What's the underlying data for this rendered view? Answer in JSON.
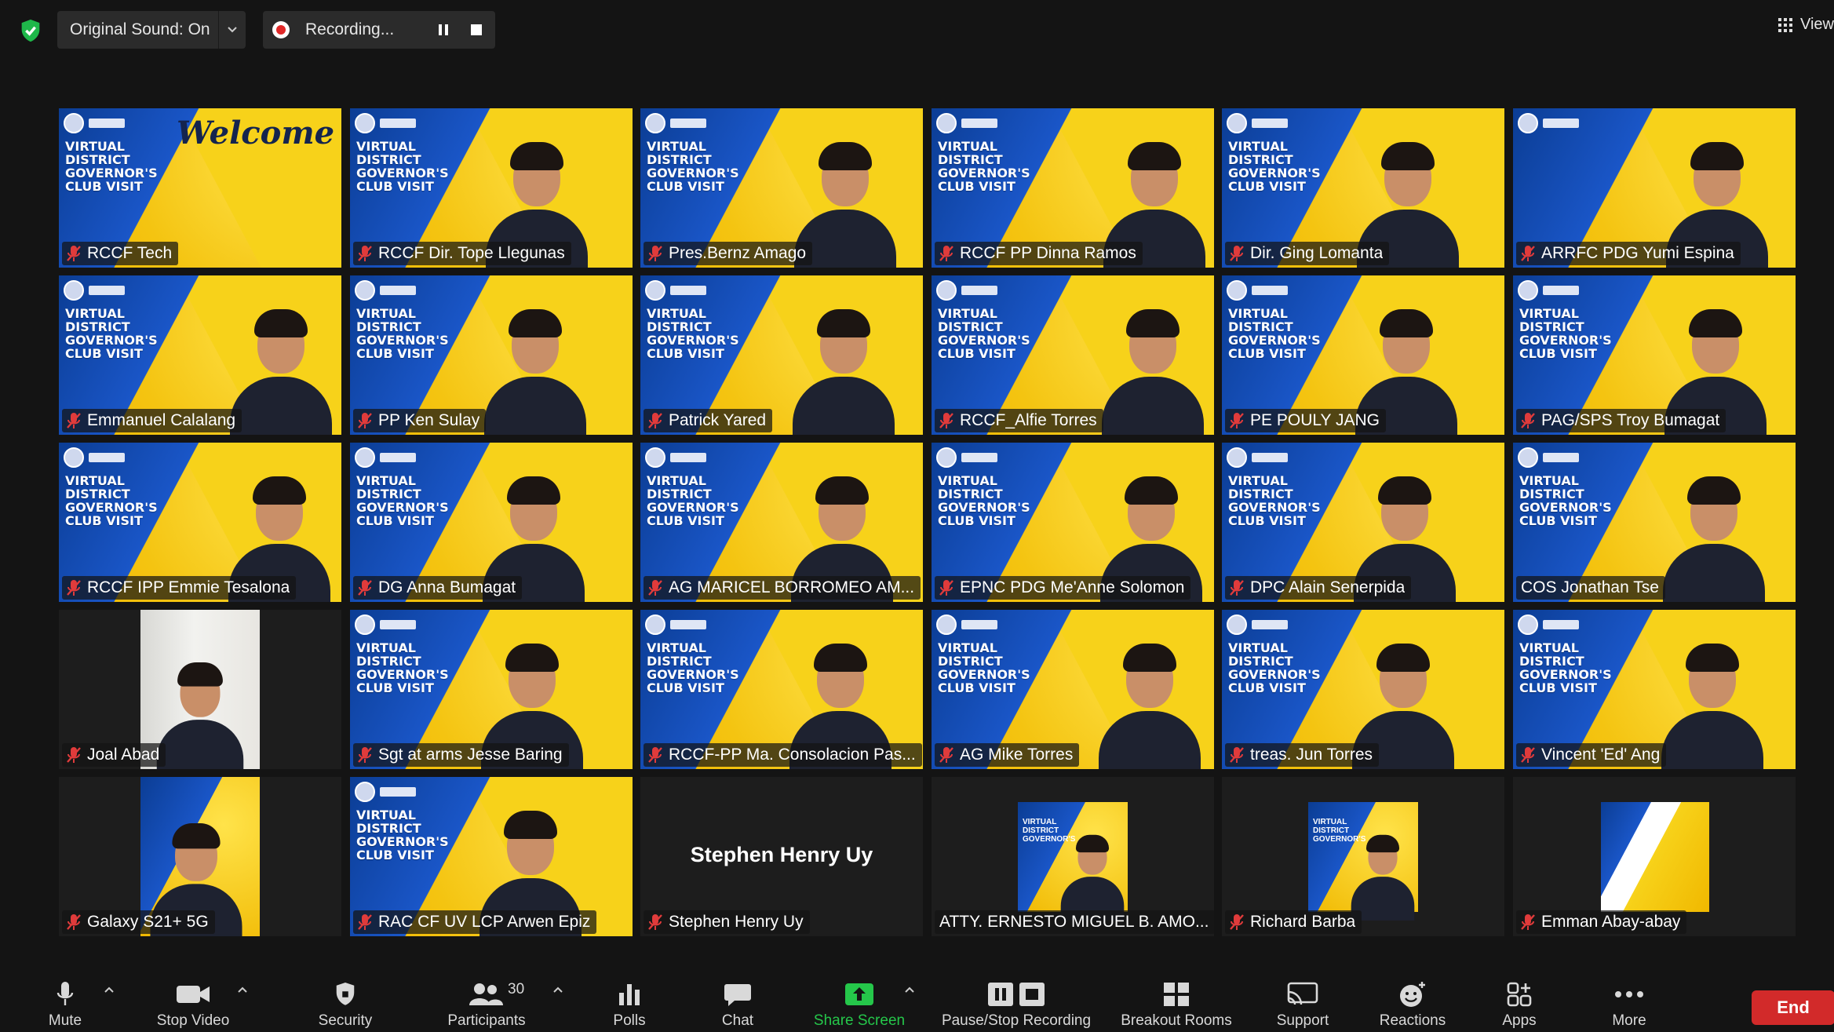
{
  "topbar": {
    "original_sound": "Original Sound: On",
    "recording": "Recording...",
    "view": "View"
  },
  "tiles": [
    {
      "name": "RCCF Tech",
      "bg": "welcome",
      "title": "Welcome",
      "poster": "VIRTUAL DISTRICT GOVERNOR'S CLUB VISIT"
    },
    {
      "name": "RCCF Dir. Tope Llegunas",
      "bg": "poster",
      "active": true,
      "poster": "VIRTUAL DISTRICT GOVERNOR'S CLUB VISIT"
    },
    {
      "name": "Pres.Bernz Amago",
      "bg": "poster",
      "poster": "VIRTUAL DISTRICT GOVERNOR'S CLUB VISIT"
    },
    {
      "name": "RCCF PP Dinna Ramos",
      "bg": "poster",
      "poster": "VIRTUAL DISTRICT GOVERNOR'S CLUB VISIT"
    },
    {
      "name": "Dir. Ging Lomanta",
      "bg": "poster",
      "poster": "VIRTUAL DISTRICT GOVERNOR'S CLUB VISIT"
    },
    {
      "name": "ARRFC PDG Yumi Espina",
      "bg": "poster",
      "poster": ""
    },
    {
      "name": "Emmanuel Calalang",
      "bg": "poster",
      "poster": "VIRTUAL DISTRICT GOVERNOR'S CLUB VISIT"
    },
    {
      "name": "PP Ken Sulay",
      "bg": "poster",
      "poster": "VIRTUAL DISTRICT GOVERNOR'S CLUB VISIT"
    },
    {
      "name": "Patrick Yared",
      "bg": "poster",
      "poster": "VIRTUAL DISTRICT GOVERNOR'S CLUB VISIT"
    },
    {
      "name": "RCCF_Alfie Torres",
      "bg": "poster",
      "poster": "VIRTUAL DISTRICT GOVERNOR'S CLUB VISIT"
    },
    {
      "name": "PE POULY JANG",
      "bg": "poster",
      "poster": "VIRTUAL DISTRICT GOVERNOR'S CLUB VISIT"
    },
    {
      "name": "PAG/SPS Troy Bumagat",
      "bg": "poster",
      "poster": "VIRTUAL DISTRICT GOVERNOR'S CLUB VISIT"
    },
    {
      "name": "RCCF IPP Emmie Tesalona",
      "bg": "poster",
      "poster": "VIRTUAL DISTRICT GOVERNOR'S CLUB VISIT"
    },
    {
      "name": "DG Anna Bumagat",
      "bg": "poster",
      "poster": "VIRTUAL DISTRICT GOVERNOR'S CLUB VISIT"
    },
    {
      "name": "AG MARICEL BORROMEO AM...",
      "bg": "poster",
      "poster": "VIRTUAL DISTRICT GOVERNOR'S CLUB VISIT"
    },
    {
      "name": "EPNC PDG Me'Anne Solomon",
      "bg": "poster",
      "poster": "VIRTUAL DISTRICT GOVERNOR'S CLUB VISIT"
    },
    {
      "name": "DPC Alain Senerpida",
      "bg": "poster",
      "poster": "VIRTUAL DISTRICT GOVERNOR'S CLUB VISIT"
    },
    {
      "name": "COS Jonathan Tse",
      "bg": "poster",
      "poster": "VIRTUAL DISTRICT GOVERNOR'S CLUB VISIT",
      "nomute": true
    },
    {
      "name": "Joal Abad",
      "bg": "room"
    },
    {
      "name": "Sgt at arms Jesse Baring",
      "bg": "poster",
      "poster": "VIRTUAL DISTRICT GOVERNOR'S CLUB VISIT"
    },
    {
      "name": "RCCF-PP Ma. Consolacion Pas...",
      "bg": "poster",
      "poster": "VIRTUAL DISTRICT GOVERNOR'S CLUB VISIT"
    },
    {
      "name": "AG Mike Torres",
      "bg": "poster",
      "poster": "VIRTUAL DISTRICT GOVERNOR'S CLUB VISIT"
    },
    {
      "name": "treas. Jun Torres",
      "bg": "poster",
      "poster": "VIRTUAL DISTRICT GOVERNOR'S CLUB VISIT"
    },
    {
      "name": "Vincent 'Ed' Ang",
      "bg": "poster",
      "poster": "VIRTUAL DISTRICT GOVERNOR'S CLUB VISIT"
    },
    {
      "name": "Galaxy S21+ 5G",
      "bg": "mini-left"
    },
    {
      "name": "RAC CF UV LCP Arwen Epiz",
      "bg": "poster",
      "poster": "VIRTUAL DISTRICT GOVERNOR'S CLUB VISIT"
    },
    {
      "name": "Stephen Henry Uy",
      "bg": "none",
      "center": "Stephen Henry Uy"
    },
    {
      "name": "ATTY. ERNESTO MIGUEL B. AMO...",
      "bg": "mini",
      "poster": "VIRTUAL DISTRICT GOVERNOR'S",
      "nomute": true
    },
    {
      "name": "Richard Barba",
      "bg": "mini",
      "poster": "VIRTUAL DISTRICT GOVERNOR'S"
    },
    {
      "name": "Emman Abay-abay",
      "bg": "white"
    }
  ],
  "toolbar": {
    "mute": "Mute",
    "stop_video": "Stop Video",
    "security": "Security",
    "participants": "Participants",
    "participants_count": "30",
    "polls": "Polls",
    "chat": "Chat",
    "share_screen": "Share Screen",
    "pause_stop_recording": "Pause/Stop Recording",
    "breakout_rooms": "Breakout Rooms",
    "support": "Support",
    "reactions": "Reactions",
    "apps": "Apps",
    "more": "More",
    "end": "End"
  },
  "colors": {
    "background": "#141414",
    "share_green": "#25c74a",
    "end_red": "#d22a2a",
    "active_speaker": "#e9f37a",
    "mute_red": "#e03b3b"
  }
}
